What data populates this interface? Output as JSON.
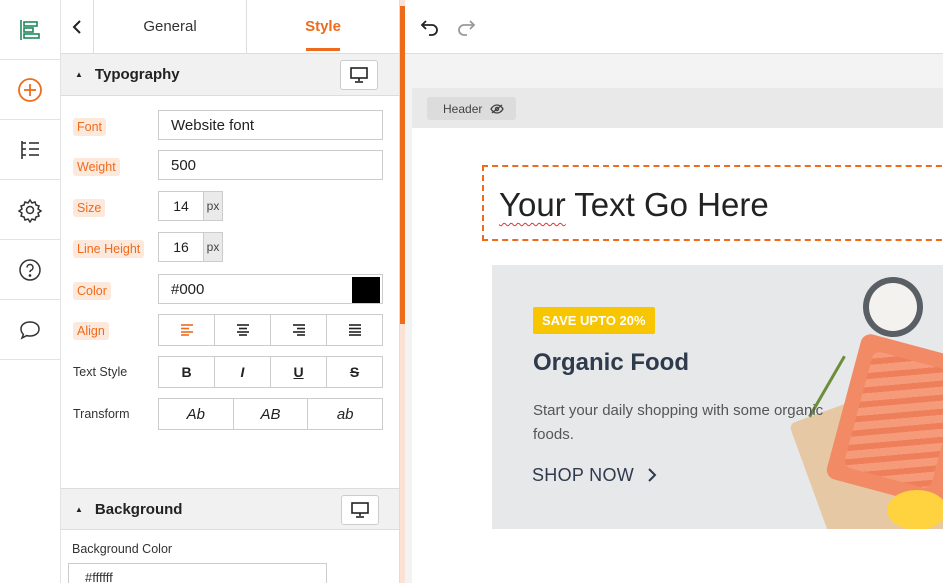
{
  "rail": {
    "items": [
      {
        "icon": "layout-icon"
      },
      {
        "icon": "add-circle-icon"
      },
      {
        "icon": "list-tree-icon"
      },
      {
        "icon": "gear-icon"
      },
      {
        "icon": "help-icon"
      },
      {
        "icon": "chat-icon"
      }
    ]
  },
  "panel": {
    "tabs": {
      "general": "General",
      "style": "Style"
    },
    "typography": {
      "title": "Typography",
      "font_label": "Font",
      "font_value": "Website font",
      "weight_label": "Weight",
      "weight_value": "500",
      "size_label": "Size",
      "size_value": "14",
      "size_unit": "px",
      "lineheight_label": "Line Height",
      "lineheight_value": "16",
      "lineheight_unit": "px",
      "color_label": "Color",
      "color_value": "#000",
      "align_label": "Align",
      "textstyle_label": "Text Style",
      "textstyle_options": [
        "B",
        "I",
        "U",
        "S"
      ],
      "transform_label": "Transform",
      "transform_options": [
        "Ab",
        "AB",
        "ab"
      ]
    },
    "background": {
      "title": "Background",
      "color_label": "Background Color",
      "color_value": "#ffffff"
    }
  },
  "canvas": {
    "header_tag": "Header",
    "heading": {
      "part1": "Your",
      "part2": " Text Go Here"
    },
    "banner": {
      "badge": "SAVE UPTO 20%",
      "title": "Organic Food",
      "description": "Start your daily shopping with some organic foods.",
      "cta": "SHOP NOW"
    }
  },
  "colors": {
    "accent": "#ee6b1c",
    "badge": "#f7c600",
    "heading": "#2f3a4c"
  }
}
